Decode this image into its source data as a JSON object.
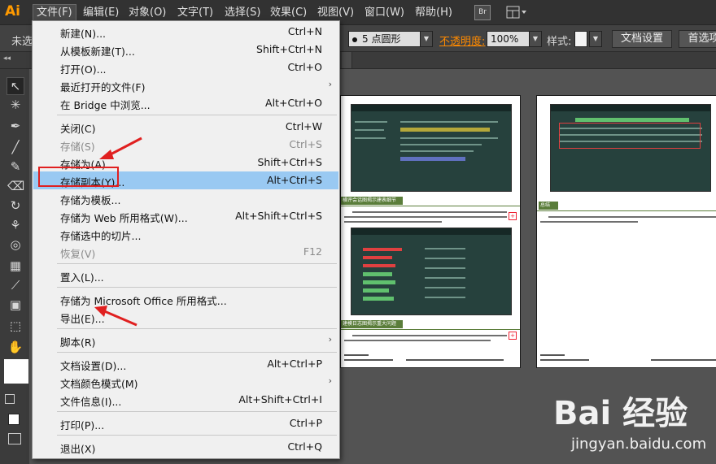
{
  "app": {
    "logo": "Ai"
  },
  "menubar": {
    "items": [
      {
        "label": "文件(F)"
      },
      {
        "label": "编辑(E)"
      },
      {
        "label": "对象(O)"
      },
      {
        "label": "文字(T)"
      },
      {
        "label": "选择(S)"
      },
      {
        "label": "效果(C)"
      },
      {
        "label": "视图(V)"
      },
      {
        "label": "窗口(W)"
      },
      {
        "label": "帮助(H)"
      }
    ],
    "bridge_label": "Br"
  },
  "control_bar": {
    "selection_label": "未选",
    "stroke_preset": "5 点圆形",
    "opacity_label": "不透明度:",
    "opacity_value": "100%",
    "style_label": "样式:",
    "doc_settings_button": "文档设置",
    "preferences_button": "首选项"
  },
  "file_menu": {
    "items": [
      {
        "label": "新建(N)...",
        "shortcut": "Ctrl+N"
      },
      {
        "label": "从模板新建(T)...",
        "shortcut": "Shift+Ctrl+N"
      },
      {
        "label": "打开(O)...",
        "shortcut": "Ctrl+O"
      },
      {
        "label": "最近打开的文件(F)",
        "shortcut": "",
        "submenu": "›"
      },
      {
        "label": "在 Bridge 中浏览...",
        "shortcut": "Alt+Ctrl+O"
      },
      {
        "label": "关闭(C)",
        "shortcut": "Ctrl+W"
      },
      {
        "label": "存储(S)",
        "shortcut": "Ctrl+S"
      },
      {
        "label": "存储为(A)...",
        "shortcut": "Shift+Ctrl+S"
      },
      {
        "label": "存储副本(Y)...",
        "shortcut": "Alt+Ctrl+S"
      },
      {
        "label": "存储为模板...",
        "shortcut": ""
      },
      {
        "label": "存储为 Web 所用格式(W)...",
        "shortcut": "Alt+Shift+Ctrl+S"
      },
      {
        "label": "存储选中的切片...",
        "shortcut": ""
      },
      {
        "label": "恢复(V)",
        "shortcut": "F12"
      },
      {
        "label": "置入(L)...",
        "shortcut": ""
      },
      {
        "label": "存储为 Microsoft Office 所用格式...",
        "shortcut": ""
      },
      {
        "label": "导出(E)...",
        "shortcut": ""
      },
      {
        "label": "脚本(R)",
        "shortcut": "",
        "submenu": "›"
      },
      {
        "label": "文档设置(D)...",
        "shortcut": "Alt+Ctrl+P"
      },
      {
        "label": "文档颜色模式(M)",
        "shortcut": "",
        "submenu": "›"
      },
      {
        "label": "文件信息(I)...",
        "shortcut": "Alt+Shift+Ctrl+I"
      },
      {
        "label": "打印(P)...",
        "shortcut": "Ctrl+P"
      },
      {
        "label": "退出(X)",
        "shortcut": "Ctrl+Q"
      }
    ]
  },
  "document": {
    "page1": {
      "section1_title": "横评会话图揭示建表细节",
      "section2_title": "建模日志图揭示重大问题"
    },
    "page2": {
      "section_title": "总结"
    }
  },
  "watermark": {
    "logo": "Bai 经验",
    "url": "jingyan.baidu.com"
  },
  "colors": {
    "menu_highlight": "#99c9f2",
    "annotation_red": "#e02020",
    "ai_brand": "#ff9a00",
    "opacity_link": "#ff8a00"
  }
}
